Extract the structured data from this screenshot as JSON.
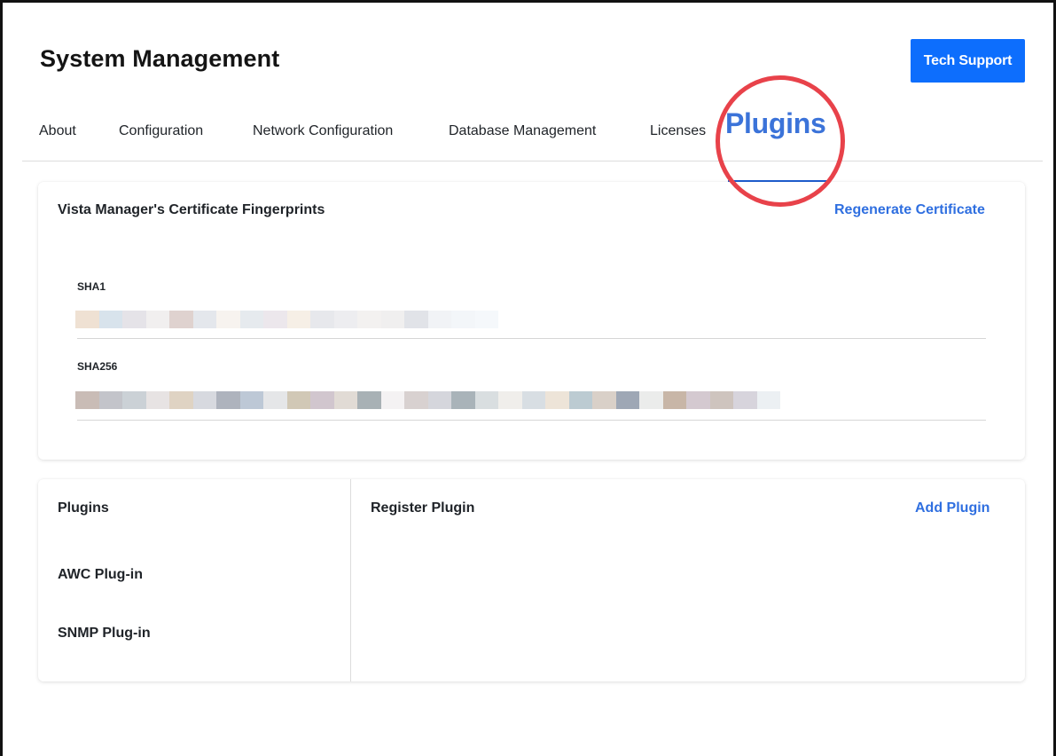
{
  "header": {
    "title": "System Management",
    "tech_support_label": "Tech Support"
  },
  "tabs": [
    {
      "label": "About"
    },
    {
      "label": "Configuration"
    },
    {
      "label": "Network Configuration"
    },
    {
      "label": "Database Management"
    },
    {
      "label": "Licenses"
    },
    {
      "label": "Plugins",
      "active": true
    }
  ],
  "certificate": {
    "title": "Vista Manager's Certificate Fingerprints",
    "regenerate_label": "Regenerate Certificate",
    "sha1_label": "SHA1",
    "sha256_label": "SHA256",
    "sha1_value_redacted": true,
    "sha256_value_redacted": true
  },
  "plugins": {
    "title": "Plugins",
    "items": [
      {
        "label": "AWC Plug-in"
      },
      {
        "label": "SNMP Plug-in"
      }
    ],
    "register_title": "Register Plugin",
    "add_label": "Add Plugin"
  },
  "colors": {
    "accent": "#0d6efd",
    "link": "#2f6fe0",
    "active_tab": "#3b73d9",
    "highlight_ring": "#e8424a"
  }
}
